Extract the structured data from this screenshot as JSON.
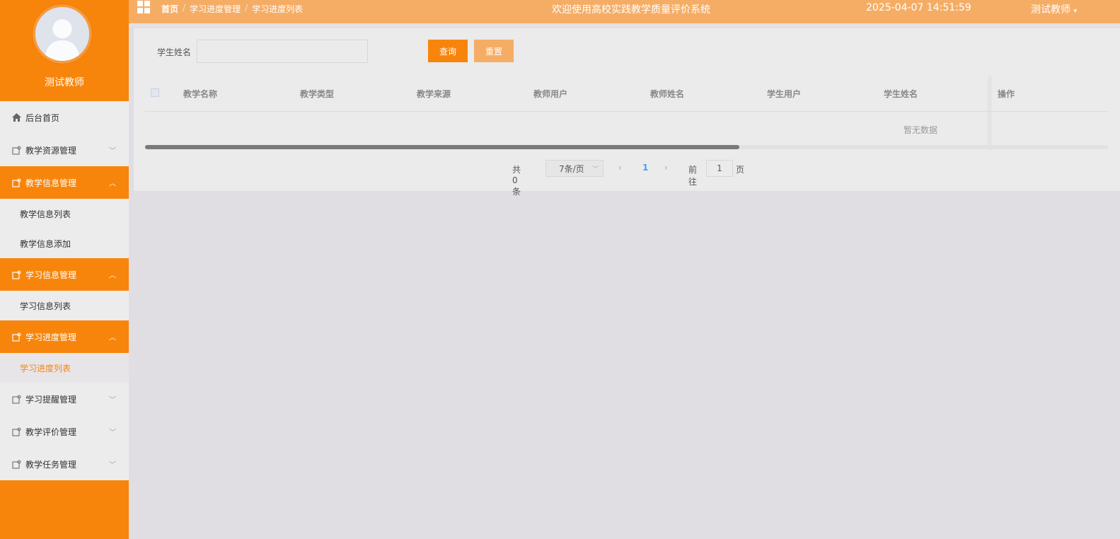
{
  "profile": {
    "name": "测试教师"
  },
  "menu": {
    "home": "后台首页",
    "resource": "教学资源管理",
    "info": "教学信息管理",
    "info_list": "教学信息列表",
    "info_add": "教学信息添加",
    "study": "学习信息管理",
    "study_list": "学习信息列表",
    "progress": "学习进度管理",
    "progress_list": "学习进度列表",
    "reminder": "学习提醒管理",
    "evaluation": "教学评价管理",
    "task": "教学任务管理"
  },
  "header": {
    "breadcrumb": [
      "首页",
      "学习进度管理",
      "学习进度列表"
    ],
    "sep": "/",
    "title": "欢迎使用高校实践教学质量评价系统",
    "datetime": "2025-04-07 14:51:59",
    "user": "测试教师"
  },
  "search": {
    "label": "学生姓名",
    "value": "",
    "query": "查询",
    "reset": "重置"
  },
  "table": {
    "columns": [
      "教学名称",
      "教学类型",
      "教学来源",
      "教师用户",
      "教师姓名",
      "学生用户",
      "学生姓名",
      "操作"
    ],
    "empty": "暂无数据"
  },
  "pager": {
    "total": "共 0 条",
    "page_size": "7条/页",
    "current": "1",
    "goto": "前往",
    "goto_value": "1",
    "unit": "页"
  },
  "colors": {
    "accent": "#f8850b",
    "header": "#f5ad65"
  }
}
